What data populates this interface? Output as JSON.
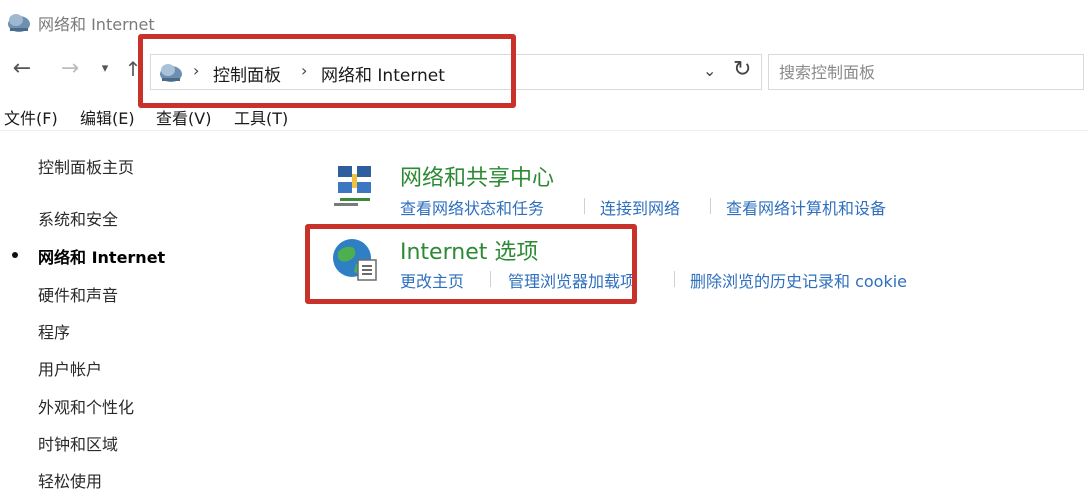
{
  "window": {
    "title": "网络和 Internet"
  },
  "nav": {
    "back_icon": "arrow-left-icon",
    "forward_icon": "arrow-right-icon",
    "history_icon": "chevron-down-icon",
    "up_icon": "arrow-up-icon"
  },
  "address": {
    "crumbs": [
      "控制面板",
      "网络和 Internet"
    ],
    "separator": "›",
    "dropdown": "⌄",
    "refresh": "↻"
  },
  "search": {
    "placeholder": "搜索控制面板"
  },
  "menu": [
    "文件(F)",
    "编辑(E)",
    "查看(V)",
    "工具(T)"
  ],
  "sidebar": {
    "home": "控制面板主页",
    "items": [
      "系统和安全",
      "网络和 Internet",
      "硬件和声音",
      "程序",
      "用户帐户",
      "外观和个性化",
      "时钟和区域",
      "轻松使用"
    ],
    "active_index": 1
  },
  "categories": [
    {
      "title": "网络和共享中心",
      "icon": "network-sharing-center-icon",
      "links": [
        "查看网络状态和任务",
        "连接到网络",
        "查看网络计算机和设备"
      ]
    },
    {
      "title": "Internet 选项",
      "icon": "internet-options-globe-icon",
      "links": [
        "更改主页",
        "管理浏览器加载项",
        "删除浏览的历史记录和 cookie"
      ]
    }
  ],
  "colors": {
    "highlight": "#c8322b",
    "category_title": "#2d8a34",
    "link": "#2e6fbf"
  }
}
